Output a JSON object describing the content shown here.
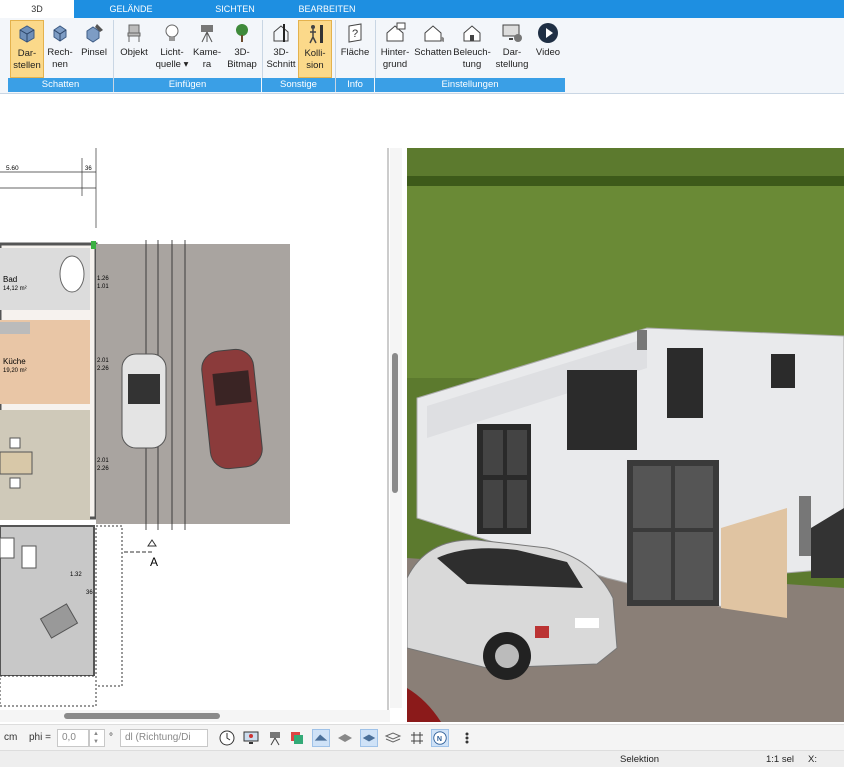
{
  "tabs": [
    "3D",
    "GELÄNDE",
    "SICHTEN",
    "BEARBEITEN"
  ],
  "ribbon": {
    "buttons": [
      {
        "label": "Dar-\nstellen"
      },
      {
        "label": "Rech-\nnen"
      },
      {
        "label": "Pinsel"
      },
      {
        "label": "Objekt"
      },
      {
        "label": "Licht-\nquelle ▾"
      },
      {
        "label": "Kame-\nra"
      },
      {
        "label": "3D-\nBitmap"
      },
      {
        "label": "3D-\nSchnitt"
      },
      {
        "label": "Kolli-\nsion"
      },
      {
        "label": "Fläche"
      },
      {
        "label": "Hinter-\ngrund"
      },
      {
        "label": "Schatten"
      },
      {
        "label": "Beleuch-\ntung"
      },
      {
        "label": "Dar-\nstellung"
      },
      {
        "label": "Video"
      }
    ],
    "groups": [
      "Schatten",
      "Einfügen",
      "Sonstige",
      "Info",
      "Einstellungen"
    ]
  },
  "plan": {
    "dims": {
      "top": "5.60",
      "top_right": "36",
      "r1": "1.26",
      "r2": "1.01",
      "r3": "2.01",
      "r4": "2.26",
      "r5": "2.01",
      "r6": "2.26",
      "r7": "1.32",
      "r8": "36"
    },
    "rooms": [
      {
        "name": "Bad",
        "area": "14,12 m²"
      },
      {
        "name": "Küche",
        "area": "19,20 m²"
      }
    ],
    "section_marker": "A"
  },
  "toolbar": {
    "unit": "cm",
    "phi_label": "phi =",
    "phi_value": "0,0",
    "degree": "°",
    "direction_placeholder": "dl (Richtung/Di"
  },
  "status": {
    "mode": "Selektion",
    "scale": "1:1 sel",
    "x_label": "X:"
  }
}
